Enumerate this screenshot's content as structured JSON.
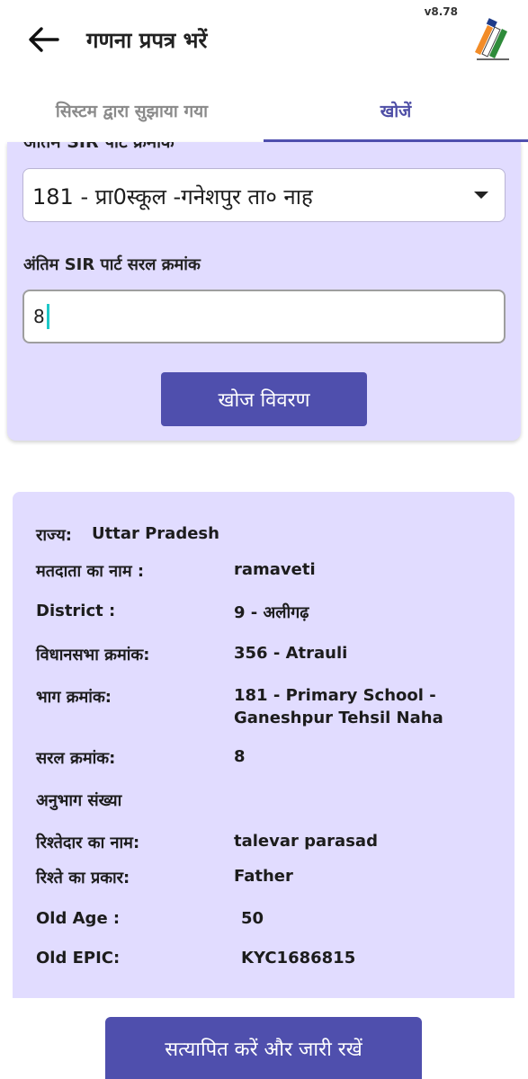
{
  "header": {
    "title": "गणना प्रपत्र भरें",
    "version": "v8.78"
  },
  "tabs": [
    {
      "label": "सिस्टम द्वारा सुझाया गया",
      "active": false
    },
    {
      "label": "खोजें",
      "active": true
    }
  ],
  "search": {
    "clipped_label": "अंतिम SIR पार्ट क्रमांक",
    "part_select_value": "181 - प्रा0स्कूल -गनेशपुर ता० नाह",
    "serial_label": "अंतिम SIR पार्ट सरल क्रमांक",
    "serial_value": "8",
    "search_button": "खोज विवरण"
  },
  "details": {
    "state_label": "राज्य:",
    "state_value": "Uttar Pradesh",
    "voter_name_label": "मतदाता का नाम :",
    "voter_name_value": "ramaveti",
    "district_label": "District :",
    "district_value": "9 - अलीगढ़",
    "assembly_label": "विधानसभा क्रमांक:",
    "assembly_value": "356 - Atrauli",
    "part_label": "भाग क्रमांक:",
    "part_value_line1": "181 - Primary School -",
    "part_value_line2": "Ganeshpur Tehsil Naha",
    "serial_label": "सरल क्रमांक:",
    "serial_value": "8",
    "section_label": "अनुभाग संख्या",
    "relative_name_label": "रिश्तेदार का नाम:",
    "relative_name_value": "talevar parasad",
    "relation_type_label": "रिश्ते का प्रकार:",
    "relation_type_value": "Father",
    "old_age_label": "Old Age :",
    "old_age_value": "50",
    "old_epic_label": "Old EPIC:",
    "old_epic_value": "KYC1686815"
  },
  "footer": {
    "verify_button": "सत्यापित करें और जारी रखें"
  },
  "colors": {
    "accent": "#4f4fad",
    "card_bg": "#e1dcff",
    "active_tab": "#4e4ea6"
  },
  "icons": {
    "back": "arrow-left-icon",
    "logo": "eci-logo-icon",
    "dropdown": "caret-down-icon"
  }
}
